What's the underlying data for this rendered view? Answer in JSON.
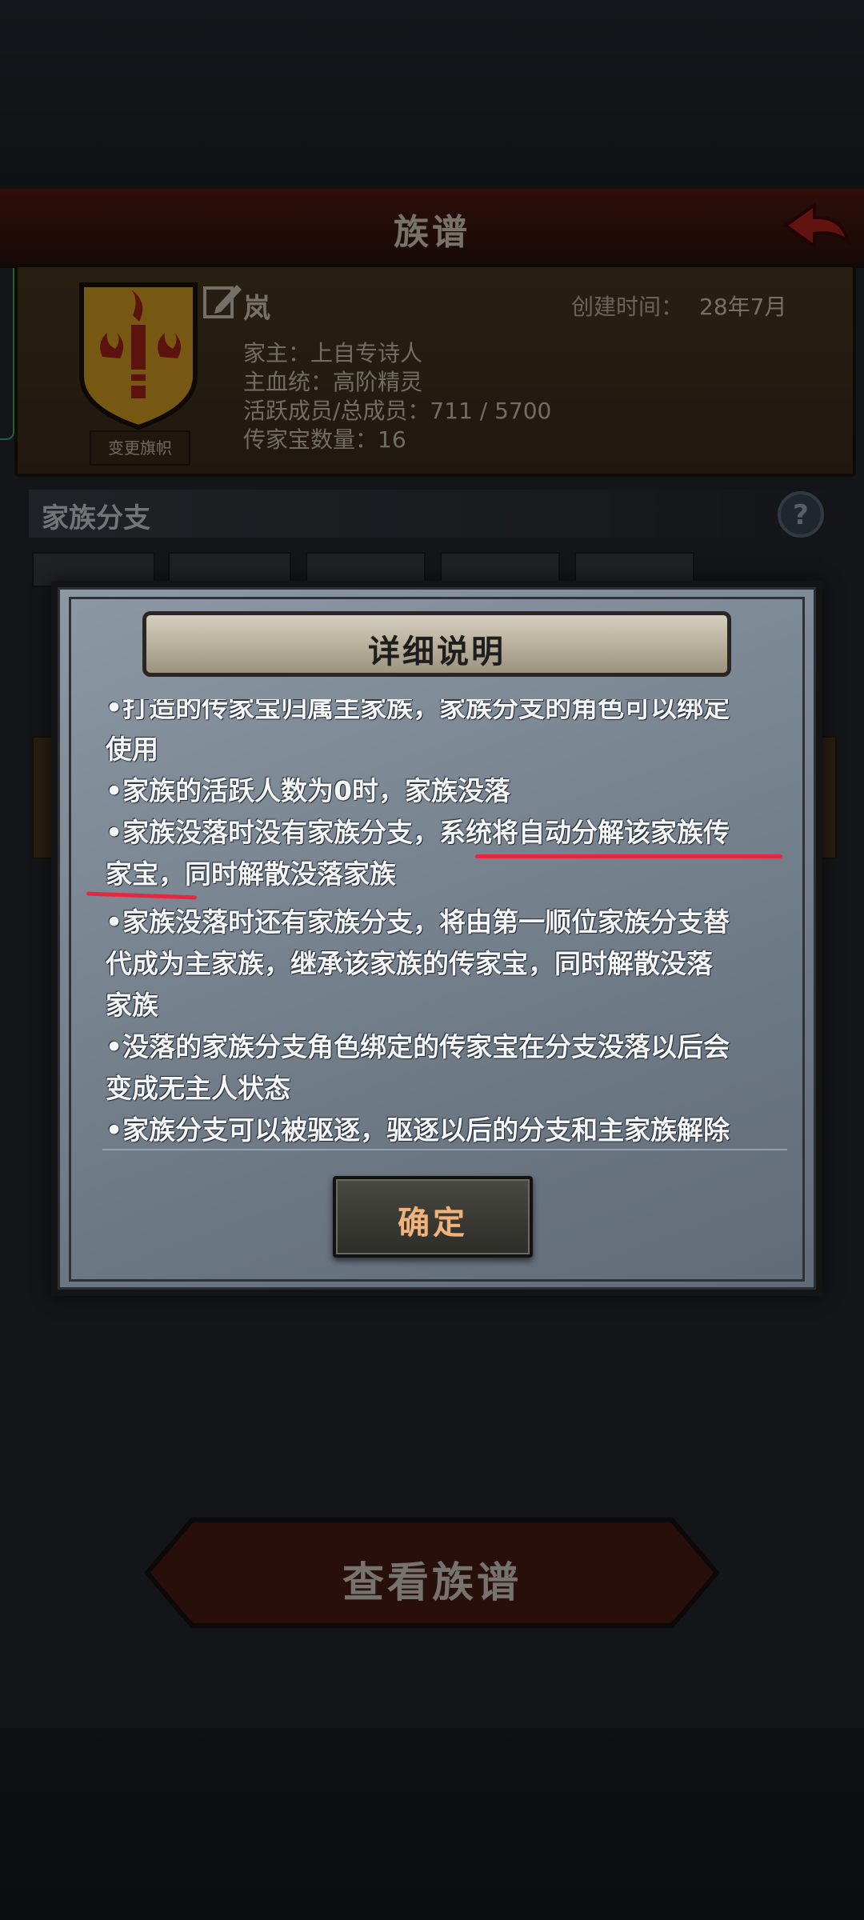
{
  "screen": {
    "title": "族谱",
    "family": {
      "name": "岚",
      "created_label": "创建时间：",
      "created_value": "28年7月",
      "banner_button": "变更旗帜",
      "info": [
        "家主：上自专诗人",
        "主血统：高阶精灵",
        "活跃成员/总成员：711 / 5700",
        "传家宝数量：16"
      ]
    },
    "branches_title": "家族分支",
    "help_label": "?",
    "view_button": "查看族谱"
  },
  "modal": {
    "title": "详细说明",
    "lines": [
      "•打造的传家宝归属主家族，家族分支的角色可以绑定",
      "使用",
      "•家族的活跃人数为0时，家族没落",
      "•家族没落时没有家族分支，系统将自动分解该家族传",
      "家宝，同时解散没落家族",
      "•家族没落时还有家族分支，将由第一顺位家族分支替",
      "代成为主家族，继承该家族的传家宝，同时解散没落",
      "家族",
      "•没落的家族分支角色绑定的传家宝在分支没落以后会",
      "变成无主人状态",
      "•家族分支可以被驱逐，驱逐以后的分支和主家族解除"
    ],
    "confirm_button": "确定"
  },
  "colors": {
    "highlight_underline": "#e8263f",
    "confirm_text": "#f0b37a"
  }
}
